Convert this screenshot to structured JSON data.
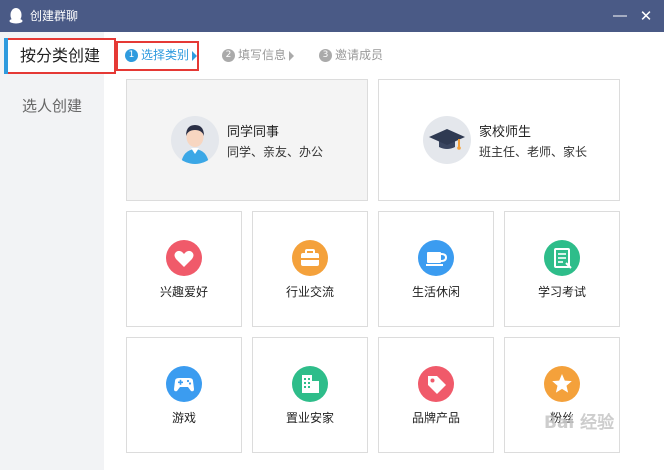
{
  "window": {
    "title": "创建群聊",
    "minimize_label": "―",
    "close_label": "✕"
  },
  "sidebar": {
    "tabs": [
      {
        "label": "按分类创建"
      },
      {
        "label": "选人创建"
      }
    ]
  },
  "steps": [
    {
      "num": "1",
      "label": "选择类别"
    },
    {
      "num": "2",
      "label": "填写信息"
    },
    {
      "num": "3",
      "label": "邀请成员"
    }
  ],
  "featured": [
    {
      "title": "同学同事",
      "subtitle": "同学、亲友、办公",
      "icon": "student-avatar-icon"
    },
    {
      "title": "家校师生",
      "subtitle": "班主任、老师、家长",
      "icon": "graduation-cap-icon"
    }
  ],
  "categories": [
    {
      "label": "兴趣爱好",
      "icon": "heart-icon",
      "color": "#f05a6a"
    },
    {
      "label": "行业交流",
      "icon": "briefcase-icon",
      "color": "#f4a13b"
    },
    {
      "label": "生活休闲",
      "icon": "coffee-cup-icon",
      "color": "#3b9cf0"
    },
    {
      "label": "学习考试",
      "icon": "notebook-icon",
      "color": "#2ebd8a"
    },
    {
      "label": "游戏",
      "icon": "gamepad-icon",
      "color": "#3b9cf0"
    },
    {
      "label": "置业安家",
      "icon": "building-icon",
      "color": "#2ebd8a"
    },
    {
      "label": "品牌产品",
      "icon": "tag-icon",
      "color": "#f05a6a"
    },
    {
      "label": "粉丝",
      "icon": "star-icon",
      "color": "#f4a13b"
    }
  ],
  "watermark": "Bai 经验"
}
